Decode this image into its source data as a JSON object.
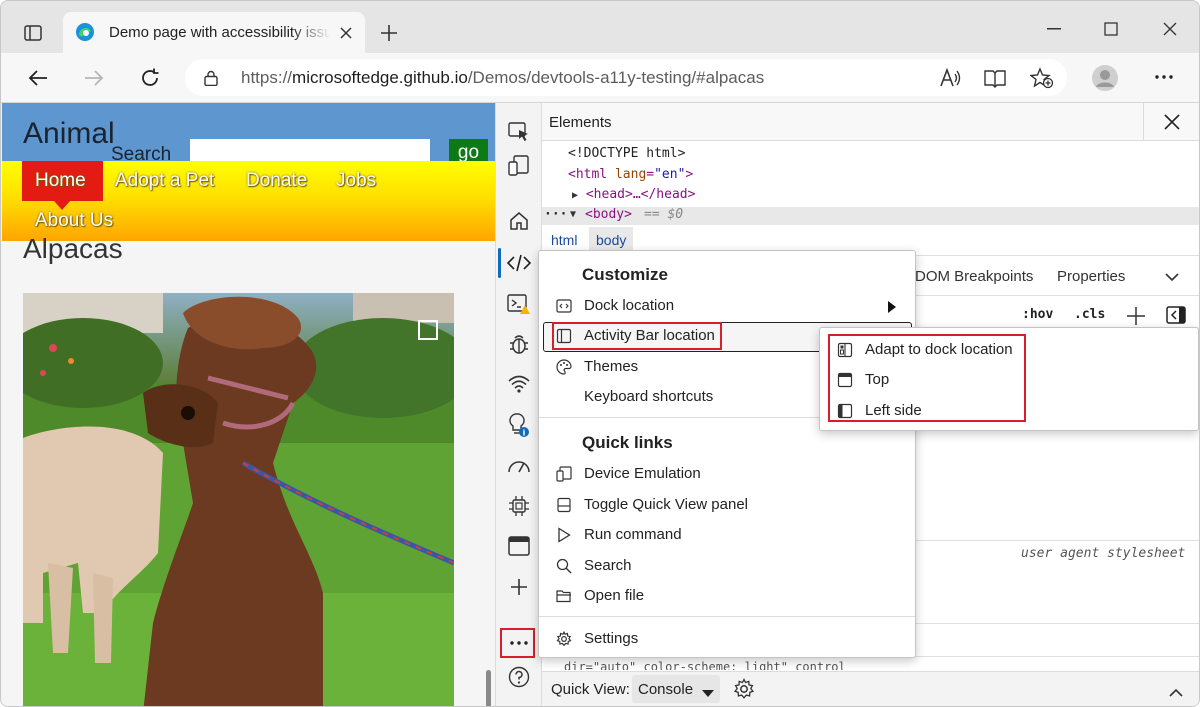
{
  "browser": {
    "tab_title": "Demo page with accessibility issues",
    "url_prefix": "https://",
    "url_domain": "microsoftedge.github.io",
    "url_path": "/Demos/devtools-a11y-testing/#alpacas"
  },
  "webpage": {
    "site_title": "Animal",
    "search_label": "Search",
    "go_button": "go",
    "nav": [
      "Home",
      "Adopt a Pet",
      "Donate",
      "Jobs",
      "About Us"
    ],
    "heading": "Alpacas"
  },
  "devtools": {
    "panel_title": "Elements",
    "dom": {
      "doctype": "<!DOCTYPE html>",
      "html_open": "<html",
      "html_attr": "lang",
      "html_val": "\"en\"",
      "html_close": ">",
      "head": "<head>…</head>",
      "body": "<body>",
      "body_note": "== $0",
      "ellipsis": "···"
    },
    "breadcrumbs": [
      "html",
      "body"
    ],
    "styles_tabs": [
      "DOM Breakpoints",
      "Properties"
    ],
    "hov": ":hov",
    "cls": ".cls",
    "stylesheet_label": "user agent stylesheet",
    "quick_view_label": "Quick View:",
    "quick_view_value": "Console"
  },
  "customize_menu": {
    "heading": "Customize",
    "items": [
      "Dock location",
      "Activity Bar location",
      "Themes",
      "Keyboard shortcuts"
    ],
    "quick_links_heading": "Quick links",
    "quick_links": [
      "Device Emulation",
      "Toggle Quick View panel",
      "Run command",
      "Search",
      "Open file"
    ],
    "settings": "Settings"
  },
  "activity_bar_submenu": {
    "items": [
      "Adapt to dock location",
      "Top",
      "Left side"
    ]
  },
  "colors": {
    "highlight_red": "#d3202c",
    "header_blue": "#5e97d0",
    "nav_red": "#e41b13",
    "go_green": "#0d7a15"
  }
}
